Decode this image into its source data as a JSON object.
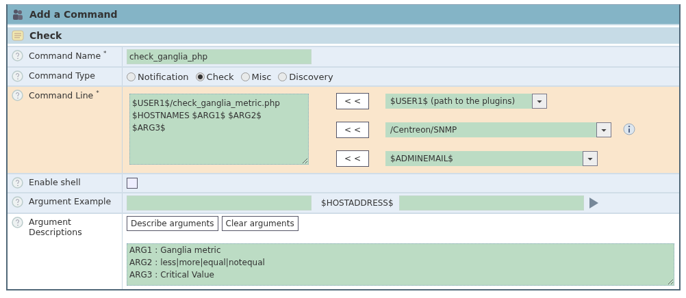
{
  "header": {
    "title": "Add a Command"
  },
  "section": {
    "title": "Check"
  },
  "command_name": {
    "label": "Command Name",
    "required_mark": "*",
    "value": "check_ganglia_php"
  },
  "command_type": {
    "label": "Command Type",
    "options": [
      {
        "label": "Notification",
        "selected": false
      },
      {
        "label": "Check",
        "selected": true
      },
      {
        "label": "Misc",
        "selected": false
      },
      {
        "label": "Discovery",
        "selected": false
      }
    ]
  },
  "command_line": {
    "label": "Command Line",
    "required_mark": "*",
    "lines": [
      "$USER1$/check_ganglia_metric.php",
      "$HOSTNAMES $ARG1$ $ARG2$",
      "$ARG3$"
    ],
    "macros": [
      {
        "button": "< <",
        "value": "$USER1$ (path to the plugins)",
        "info": false
      },
      {
        "button": "< <",
        "value": "/Centreon/SNMP",
        "info": true
      },
      {
        "button": "< <",
        "value": "$ADMINEMAIL$",
        "info": false
      }
    ]
  },
  "enable_shell": {
    "label": "Enable shell",
    "checked": false
  },
  "argument_example": {
    "label": "Argument Example",
    "macro_label": "$HOSTADDRESS$"
  },
  "argument_descriptions": {
    "label": "Argument Descriptions",
    "buttons": [
      "Describe arguments",
      "Clear arguments"
    ],
    "lines": [
      "ARG1 : Ganglia metric",
      "ARG2 : less|more|equal|notequal",
      "ARG3 : Critical Value"
    ]
  }
}
